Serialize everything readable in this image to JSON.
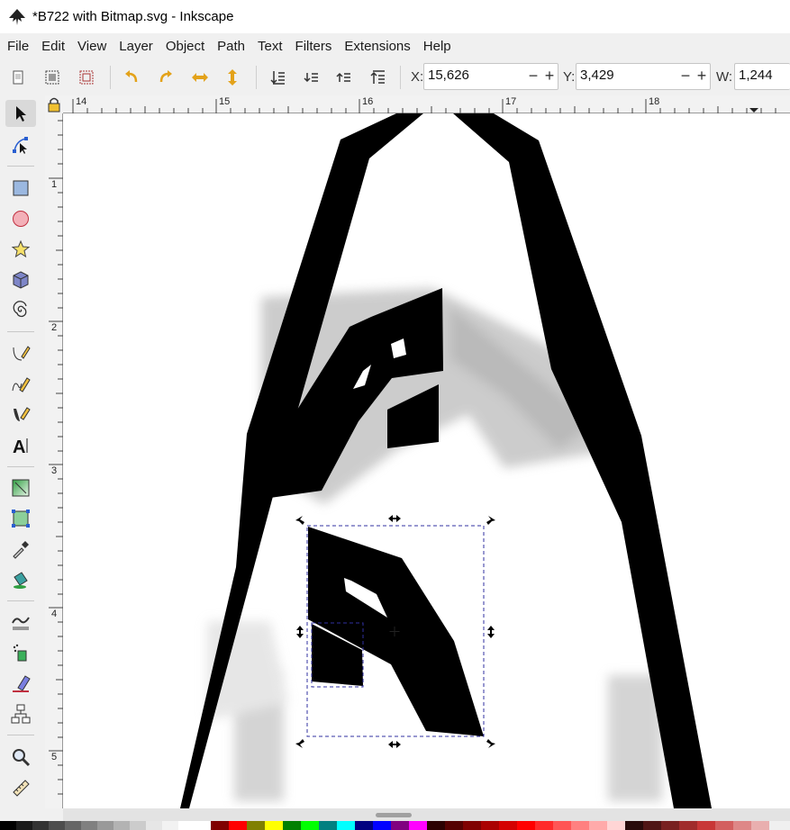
{
  "window": {
    "title": "*B722 with Bitmap.svg - Inkscape"
  },
  "menu": [
    "File",
    "Edit",
    "View",
    "Layer",
    "Object",
    "Path",
    "Text",
    "Filters",
    "Extensions",
    "Help"
  ],
  "toolbar": {
    "x_label": "X:",
    "x_value": "15,626",
    "y_label": "Y:",
    "y_value": "3,429",
    "w_label": "W:",
    "w_value": "1,244",
    "minus": "−",
    "plus": "+",
    "buttons": [
      "select-all-icon",
      "select-all-layers-icon",
      "deselect-icon",
      "rotate-ccw-icon",
      "rotate-cw-icon",
      "flip-horizontal-icon",
      "flip-vertical-icon",
      "lower-to-bottom-icon",
      "lower-icon",
      "raise-icon",
      "raise-to-top-icon"
    ]
  },
  "tools": [
    "selector-tool",
    "node-tool",
    "rectangle-tool",
    "ellipse-tool",
    "star-tool",
    "3d-box-tool",
    "spiral-tool",
    "pencil-tool",
    "pen-tool",
    "calligraphy-tool",
    "text-tool",
    "gradient-tool",
    "mesh-tool",
    "dropper-tool",
    "paint-bucket-tool",
    "tweak-tool",
    "spray-tool",
    "eraser-tool",
    "connector-tool",
    "zoom-tool",
    "measure-tool"
  ],
  "rulers": {
    "horizontal": [
      "14",
      "15",
      "16",
      "17",
      "18"
    ],
    "vertical": [
      "1",
      "2",
      "3",
      "4",
      "5"
    ]
  },
  "colors": {
    "accent": "#e3a21a",
    "selection": "#3030a0",
    "ink": "#000000"
  },
  "palette": [
    "#000000",
    "#1a1a1a",
    "#333333",
    "#4d4d4d",
    "#666666",
    "#808080",
    "#999999",
    "#b3b3b3",
    "#cccccc",
    "#e6e6e6",
    "#f2f2f2",
    "#ffffff",
    "#ffffff",
    "#800000",
    "#ff0000",
    "#808000",
    "#ffff00",
    "#008000",
    "#00ff00",
    "#008080",
    "#00ffff",
    "#000080",
    "#0000ff",
    "#800080",
    "#ff00ff",
    "#2b0000",
    "#550000",
    "#800000",
    "#aa0000",
    "#d40000",
    "#ff0000",
    "#ff2a2a",
    "#ff5555",
    "#ff8080",
    "#ffaaaa",
    "#ffd5d5",
    "#280b0b",
    "#501616",
    "#782121",
    "#a02c2c",
    "#c83737",
    "#d35f5f",
    "#de8787",
    "#e9afaf"
  ]
}
